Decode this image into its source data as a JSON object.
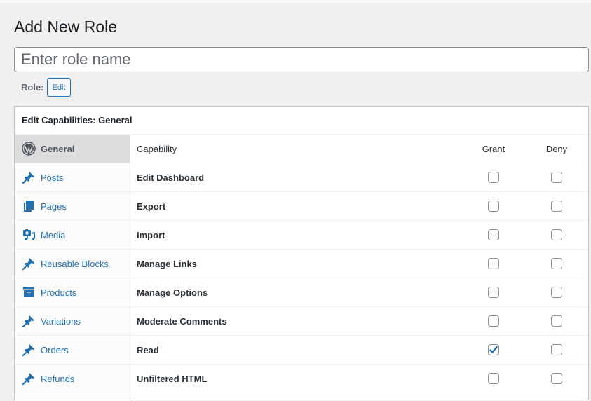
{
  "page": {
    "title": "Add New Role"
  },
  "role_name_input": {
    "value": "",
    "placeholder": "Enter role name"
  },
  "role": {
    "label": "Role:",
    "edit_button": "Edit"
  },
  "capabilities_panel": {
    "header": "Edit Capabilities: General",
    "tabs": [
      {
        "label": "General",
        "icon": "wordpress-icon",
        "active": true
      },
      {
        "label": "Posts",
        "icon": "pushpin-icon",
        "active": false
      },
      {
        "label": "Pages",
        "icon": "pages-icon",
        "active": false
      },
      {
        "label": "Media",
        "icon": "media-icon",
        "active": false
      },
      {
        "label": "Reusable Blocks",
        "icon": "pushpin-icon",
        "active": false
      },
      {
        "label": "Products",
        "icon": "archive-icon",
        "active": false
      },
      {
        "label": "Variations",
        "icon": "pushpin-icon",
        "active": false
      },
      {
        "label": "Orders",
        "icon": "pushpin-icon",
        "active": false
      },
      {
        "label": "Refunds",
        "icon": "pushpin-icon",
        "active": false
      }
    ],
    "columns": {
      "capability": "Capability",
      "grant": "Grant",
      "deny": "Deny"
    },
    "rows": [
      {
        "capability": "Edit Dashboard",
        "grant": false,
        "deny": false
      },
      {
        "capability": "Export",
        "grant": false,
        "deny": false
      },
      {
        "capability": "Import",
        "grant": false,
        "deny": false
      },
      {
        "capability": "Manage Links",
        "grant": false,
        "deny": false
      },
      {
        "capability": "Manage Options",
        "grant": false,
        "deny": false
      },
      {
        "capability": "Moderate Comments",
        "grant": false,
        "deny": false
      },
      {
        "capability": "Read",
        "grant": true,
        "deny": false
      },
      {
        "capability": "Unfiltered HTML",
        "grant": false,
        "deny": false
      }
    ]
  },
  "colors": {
    "accent": "#2271b1",
    "active_tab_bg": "#dcdcde",
    "page_bg": "#f0f0f1"
  }
}
